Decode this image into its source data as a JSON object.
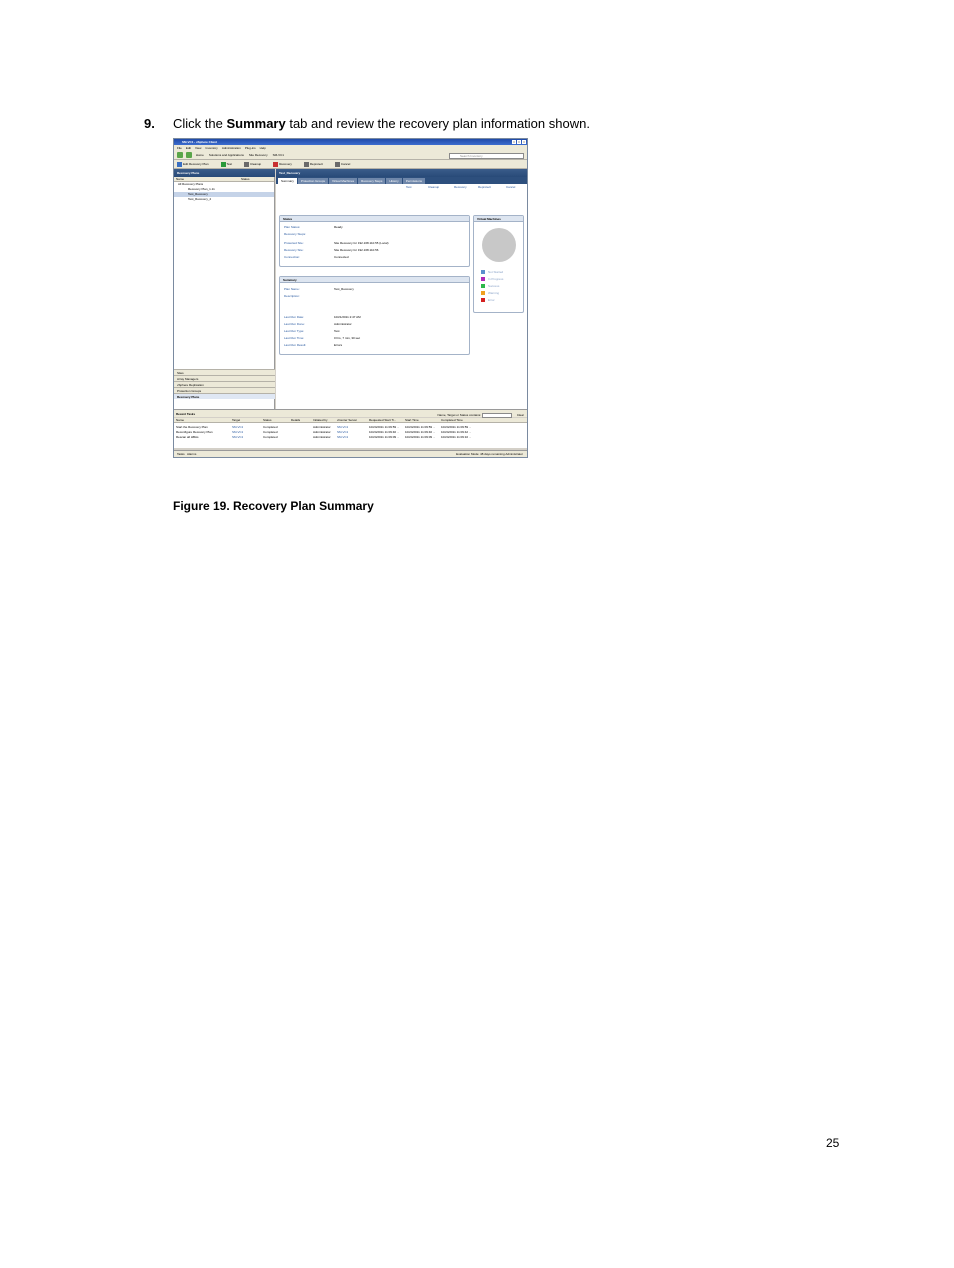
{
  "instruction": {
    "number": "9.",
    "pre": "Click the ",
    "bold": "Summary",
    "post": " tab and review the recovery plan information shown."
  },
  "figure": {
    "window_title": "SM-VC1 - vSphere Client",
    "menu": [
      "File",
      "Edit",
      "View",
      "Inventory",
      "Administration",
      "Plug-ins",
      "Help"
    ],
    "breadcrumbs": [
      "Home",
      "Solutions and Applications",
      "Site Recovery",
      "SM-VC1"
    ],
    "search_placeholder": "Search Inventory",
    "toolbar": [
      "Edit Recovery Plan",
      "Test",
      "Cleanup",
      "Recovery",
      "Reprotect",
      "Cancel"
    ],
    "left_header": "Recovery Plans",
    "left_columns": [
      "Name",
      "Status"
    ],
    "tree": [
      "All Recovery Plans",
      "Recovery Plan_1.11",
      "Test_Recovery",
      "Test_Recovery_2"
    ],
    "left_bottom": [
      "Sites",
      "Array Managers",
      "vSphere Replication",
      "Protection Groups",
      "Recovery Plans"
    ],
    "right_header": "Test_Recovery",
    "tabs": [
      "Summary",
      "Protection Groups",
      "Virtual Machines",
      "Recovery Steps",
      "History",
      "Permissions"
    ],
    "actions": [
      "Test",
      "Cleanup",
      "Recovery",
      "Reprotect",
      "Cancel"
    ],
    "status_box": {
      "title": "Status",
      "rows": [
        {
          "k": "Plan Status:",
          "v": "Ready"
        },
        {
          "k": "Recovery Steps:",
          "v": ""
        },
        {
          "k": "Protected Site:",
          "v": "Site Recovery for 192.168.110.55 (Local)"
        },
        {
          "k": "Recovery Site:",
          "v": "Site Recovery for 192.168.110.56"
        },
        {
          "k": "Connection:",
          "v": "Connected"
        }
      ]
    },
    "summary_box": {
      "title": "Summary",
      "rows": [
        {
          "k": "Plan Name:",
          "v": "Test_Recovery"
        },
        {
          "k": "Description:",
          "v": ""
        },
        {
          "k": "Last Run Date:",
          "v": "10/21/2011 2:47 AM"
        },
        {
          "k": "Last Run Done:",
          "v": "Administrator"
        },
        {
          "k": "Last Run Type:",
          "v": "Test"
        },
        {
          "k": "Last Run Time:",
          "v": "0 hrs, 7 min, 30 sec"
        },
        {
          "k": "Last Run Result:",
          "v": "Errors"
        }
      ]
    },
    "vm_box": {
      "title": "Virtual Machines",
      "legend": [
        {
          "label": "Not Started",
          "color": "#5b8fcc"
        },
        {
          "label": "In Progress",
          "color": "#b02ab8"
        },
        {
          "label": "Success",
          "color": "#2db84a"
        },
        {
          "label": "Warning",
          "color": "#f0a020"
        },
        {
          "label": "Error",
          "color": "#d42020"
        }
      ]
    },
    "tasks": {
      "title": "Recent Tasks",
      "filter": "Name, Target or Status contains:",
      "clear": "Clear",
      "columns": [
        "Name",
        "Target",
        "Status",
        "Details",
        "Initiated by",
        "vCenter Server",
        "Requested Start Ti...",
        "Start Time",
        "Completed Time"
      ],
      "rows": [
        [
          "Start the Recovery Plan",
          "SM-VC1",
          "Completed",
          "",
          "Administrator",
          "SM-VC1",
          "10/24/2011 11:09:59 ...",
          "10/24/2011 11:09:59 ...",
          "10/24/2011 11:09:59 ..."
        ],
        [
          "Reconfigure Recovery Plan",
          "SM-VC1",
          "Completed",
          "",
          "Administrator",
          "SM-VC1",
          "10/24/2011 11:09:40 ...",
          "10/24/2011 11:09:40 ...",
          "10/24/2011 11:09:42 ..."
        ],
        [
          "Rescan all HBAs",
          "SM-VC1",
          "Completed",
          "",
          "Administrator",
          "SM-VC1",
          "10/24/2011 11:09:09 ...",
          "10/24/2011 11:09:09 ...",
          "10/24/2011 11:09:10 ..."
        ]
      ]
    },
    "statusbar": {
      "tasks": "Tasks",
      "alarms": "Alarms",
      "right": "Evaluation Mode: 48 days remaining    Administrator"
    }
  },
  "caption": "Figure 19. Recovery Plan Summary",
  "page_number": "25"
}
